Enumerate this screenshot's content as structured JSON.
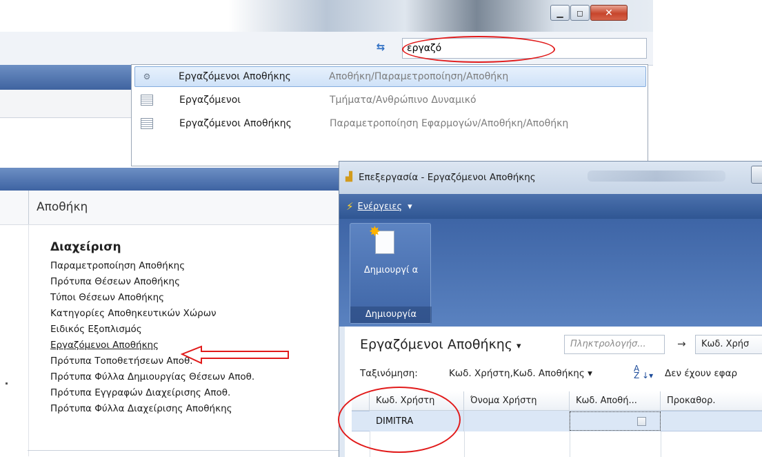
{
  "top_window": {
    "search_value": "εργαζό",
    "dropdown_results": [
      {
        "name": "Εργαζόμενοι Αποθήκης",
        "path": "Αποθήκη/Παραμετροποίηση/Αποθήκη",
        "icon": "gear-icon",
        "selected": true
      },
      {
        "name": "Εργαζόμενοι",
        "path": "Τμήματα/Ανθρώπινο Δυναμικό",
        "icon": "list-icon",
        "selected": false
      },
      {
        "name": "Εργαζόμενοι Αποθήκης",
        "path": "Παραμετροποίηση Εφαρμογών/Αποθήκη/Αποθήκη",
        "icon": "list-icon",
        "selected": false
      }
    ],
    "window_buttons": {
      "minimize": "▁",
      "maximize": "◻",
      "close": "✕"
    }
  },
  "role_center": {
    "title": "Αποθήκη",
    "section_heading": "Διαχείριση",
    "links": [
      "Παραμετροποίηση Αποθήκης",
      "Πρότυπα Θέσεων Αποθήκης",
      "Τύποι Θέσεων Αποθήκης",
      "Κατηγορίες Αποθηκευτικών Χώρων",
      "Ειδικός Εξοπλισμός",
      "Εργαζόμενοι Αποθήκης",
      "Πρότυπα Τοποθετήσεων Αποθ.",
      "Πρότυπα Φύλλα Δημιουργίας Θέσεων Αποθ.",
      "Πρότυπα Εγγραφών Διαχείρισης Αποθ.",
      "Πρότυπα Φύλλα Διαχείρισης Αποθήκης"
    ],
    "highlighted_link_index": 5
  },
  "edit_window": {
    "title": "Επεξεργασία - Εργαζόμενοι Αποθήκης",
    "actions_menu": "Ενέργειες",
    "ribbon": {
      "new_button": "Δημιουργί α",
      "group_label": "Δημιουργία"
    },
    "page_title": "Εργαζόμενοι Αποθήκης",
    "page_title_arrow": "▾",
    "filter_placeholder": "Πληκτρολογήσ...",
    "filter_field": "Κωδ. Χρήσ",
    "sort_label": "Ταξινόμηση:",
    "sort_value": "Κωδ. Χρήστη,Κωδ. Αποθήκης ▾",
    "filter_status": "Δεν έχουν εφαρ",
    "columns": [
      "Κωδ. Χρήστη",
      "Όνομα Χρήστη",
      "Κωδ. Αποθή...",
      "Προκαθορ."
    ],
    "rows": [
      {
        "user_code": "DIMITRA",
        "user_name": "",
        "location_code": "",
        "default": false
      }
    ]
  },
  "colors": {
    "annotation_red": "#e11a1a",
    "nav_blue": "#3f63a0"
  }
}
